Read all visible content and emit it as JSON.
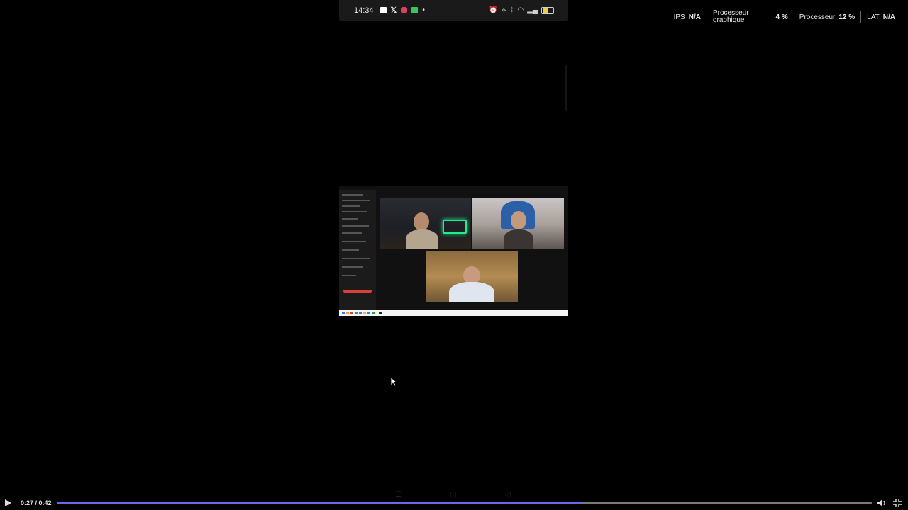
{
  "phone_status": {
    "time": "14:34",
    "left_icons": [
      "notification-square-icon",
      "x-app-icon",
      "red-app-icon",
      "green-app-icon",
      "dot-icon"
    ],
    "right_icons": [
      "alarm-icon",
      "vibrate-icon",
      "bluetooth-icon",
      "wifi-icon",
      "signal-icon",
      "battery-icon"
    ]
  },
  "perf_overlay": {
    "ips_label": "IPS",
    "ips_value": "N/A",
    "gpu_label_line1": "Processeur",
    "gpu_label_line2": "graphique",
    "gpu_value": "4 %",
    "cpu_label": "Processeur",
    "cpu_value": "12 %",
    "lat_label": "LAT",
    "lat_value": "N/A"
  },
  "video": {
    "timecode": "0:27 / 0:42",
    "progress_fraction": 0.643,
    "progress_color": "#6b67e8"
  },
  "icons": {
    "play": "play-icon",
    "volume": "volume-icon",
    "fullscreen": "exit-fullscreen-icon",
    "cursor": "mouse-cursor-icon"
  }
}
